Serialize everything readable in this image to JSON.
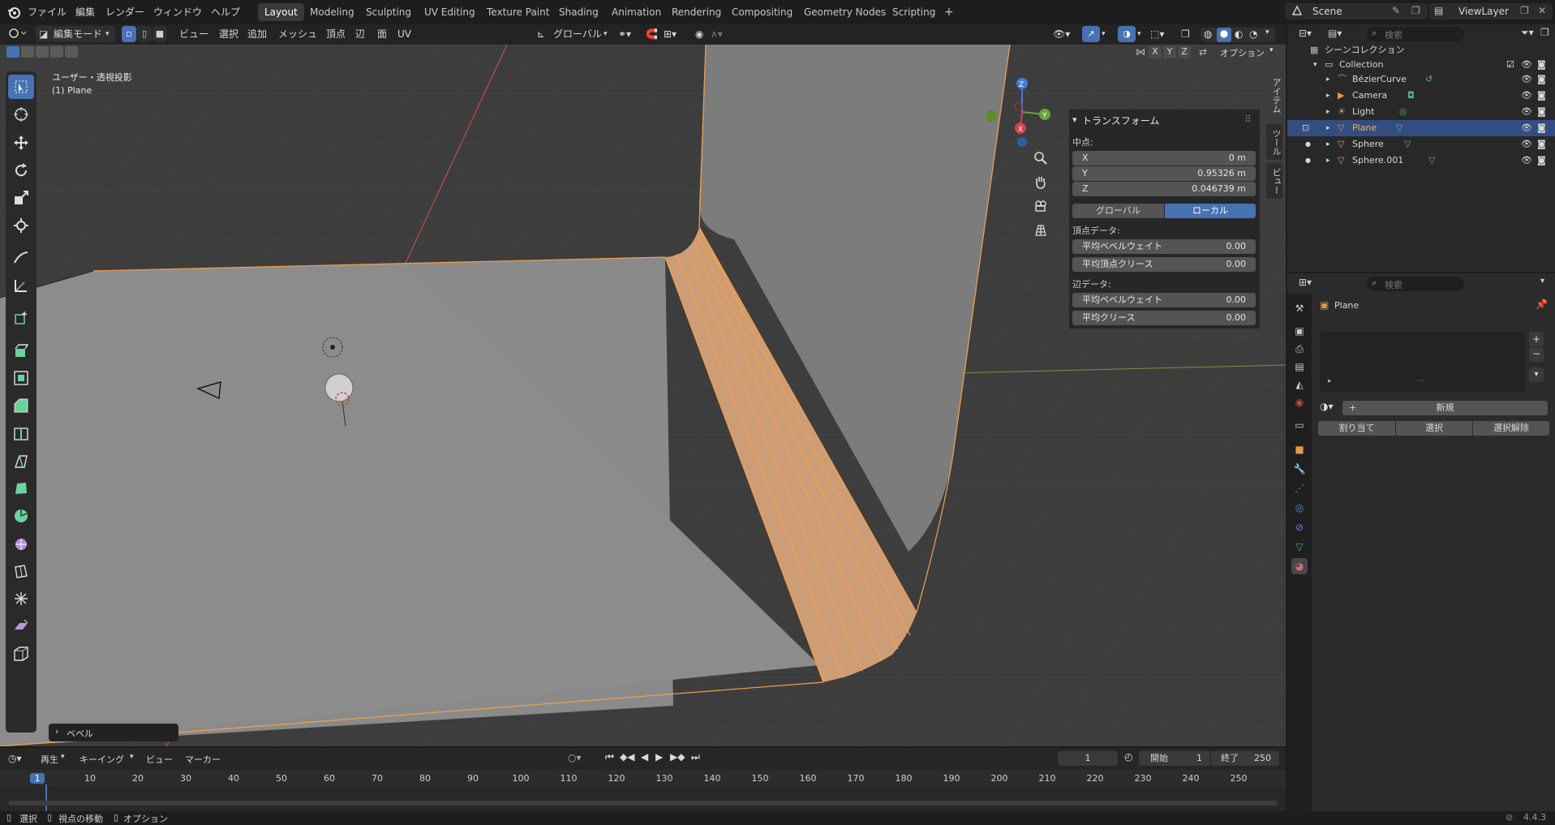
{
  "menus": [
    "ファイル",
    "編集",
    "レンダー",
    "ウィンドウ",
    "ヘルプ"
  ],
  "workspaces": [
    {
      "label": "Layout",
      "active": true
    },
    {
      "label": "Modeling"
    },
    {
      "label": "Sculpting"
    },
    {
      "label": "UV Editing"
    },
    {
      "label": "Texture Paint"
    },
    {
      "label": "Shading"
    },
    {
      "label": "Animation"
    },
    {
      "label": "Rendering"
    },
    {
      "label": "Compositing"
    },
    {
      "label": "Geometry Nodes"
    },
    {
      "label": "Scripting"
    }
  ],
  "add_workspace": "+",
  "scene": "Scene",
  "viewlayer": "ViewLayer",
  "viewport_header": {
    "mode": "編集モード",
    "menus": [
      "ビュー",
      "選択",
      "追加",
      "メッシュ",
      "頂点",
      "辺",
      "面",
      "UV"
    ],
    "orientation": "グローバル",
    "axes": [
      "X",
      "Y",
      "Z"
    ],
    "options": "オプション"
  },
  "viewport": {
    "view_name": "ユーザー・透視投影",
    "object_name": "(1) Plane",
    "operator_panel": "ベベル",
    "gizmo": {
      "z": "Z",
      "y": "Y",
      "x": "X"
    }
  },
  "npanel": {
    "title": "トランスフォーム",
    "center_label": "中点:",
    "x": {
      "label": "X",
      "value": "0 m"
    },
    "y": {
      "label": "Y",
      "value": "0.95326 m"
    },
    "z": {
      "label": "Z",
      "value": "0.046739 m"
    },
    "global": "グローバル",
    "local": "ローカル",
    "vertex_data": "頂点データ:",
    "v_bevel": {
      "label": "平均ベベルウェイト",
      "value": "0.00"
    },
    "v_crease": {
      "label": "平均頂点クリース",
      "value": "0.00"
    },
    "edge_data": "辺データ:",
    "e_bevel": {
      "label": "平均ベベルウェイト",
      "value": "0.00"
    },
    "e_crease": {
      "label": "平均クリース",
      "value": "0.00"
    },
    "tabs": [
      "アイテム",
      "ツール",
      "ビュー"
    ]
  },
  "outliner": {
    "search_placeholder": "検索",
    "scene_collection": "シーンコレクション",
    "collection": "Collection",
    "items": [
      {
        "name": "BézierCurve",
        "icon": "curve-icon"
      },
      {
        "name": "Camera",
        "icon": "camera-icon"
      },
      {
        "name": "Light",
        "icon": "light-icon"
      },
      {
        "name": "Plane",
        "icon": "mesh-icon",
        "selected": true
      },
      {
        "name": "Sphere",
        "icon": "mesh-icon"
      },
      {
        "name": "Sphere.001",
        "icon": "mesh-icon"
      }
    ]
  },
  "properties": {
    "search_placeholder": "検索",
    "object_name": "Plane",
    "new": "新規",
    "assign": "割り当て",
    "select": "選択",
    "deselect": "選択解除"
  },
  "timeline": {
    "menus": [
      "再生",
      "キーイング",
      "ビュー",
      "マーカー"
    ],
    "current_frame": "1",
    "start_label": "開始",
    "start": "1",
    "end_label": "終了",
    "end": "250",
    "ticks": [
      "1",
      "10",
      "20",
      "30",
      "40",
      "50",
      "60",
      "70",
      "80",
      "90",
      "100",
      "110",
      "120",
      "130",
      "140",
      "150",
      "160",
      "170",
      "180",
      "190",
      "200",
      "210",
      "220",
      "230",
      "240",
      "250"
    ]
  },
  "statusbar": {
    "select": "選択",
    "move_view": "視点の移動",
    "options": "オプション",
    "version": "4.4.3"
  },
  "colors": {
    "accent": "#4772b3",
    "selection": "#f5a04c",
    "outliner_selected": "#334d80"
  }
}
